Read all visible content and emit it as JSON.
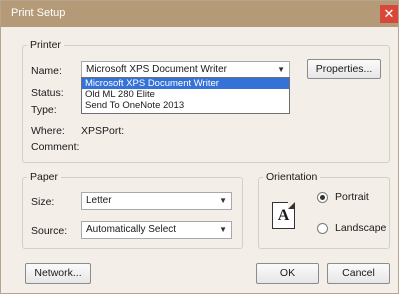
{
  "window": {
    "title": "Print Setup",
    "close_glyph": "✕"
  },
  "printer": {
    "group_label": "Printer",
    "name_label": "Name:",
    "name_value": "Microsoft XPS Document Writer",
    "properties_button": "Properties...",
    "status_label": "Status:",
    "type_label": "Type:",
    "where_label": "Where:",
    "where_value": "XPSPort:",
    "comment_label": "Comment:",
    "dropdown_options": [
      "Microsoft XPS Document Writer",
      "Old ML 280 Elite",
      "Send To OneNote 2013"
    ]
  },
  "paper": {
    "group_label": "Paper",
    "size_label": "Size:",
    "size_value": "Letter",
    "source_label": "Source:",
    "source_value": "Automatically Select"
  },
  "orientation": {
    "group_label": "Orientation",
    "icon_letter": "A",
    "portrait_label": "Portrait",
    "landscape_label": "Landscape",
    "selected": "Portrait"
  },
  "buttons": {
    "network": "Network...",
    "ok": "OK",
    "cancel": "Cancel"
  },
  "icons": {
    "close": "close-icon",
    "dropdown": "chevron-down-icon",
    "orientation": "portrait-page-icon"
  }
}
